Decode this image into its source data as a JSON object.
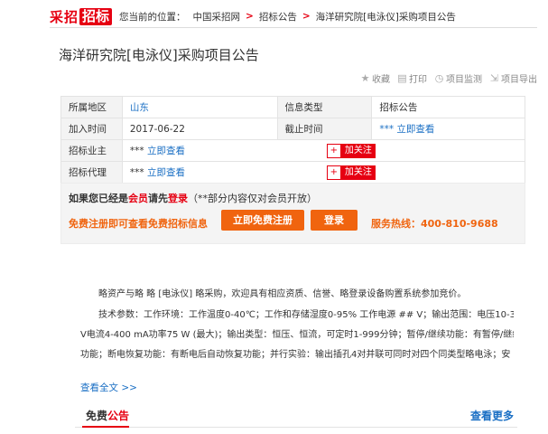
{
  "header": {
    "logo_part1": "采招",
    "logo_part2": "招标",
    "location_label": "您当前的位置：",
    "breadcrumb": [
      "中国采招网",
      "招标公告",
      "海洋研究院[电泳仪]采购项目公告"
    ],
    "separator": ">"
  },
  "title": "海洋研究院[电泳仪]采购项目公告",
  "actions": [
    {
      "icon": "star-icon",
      "glyph": "★",
      "label": "收藏"
    },
    {
      "icon": "print-icon",
      "glyph": "▤",
      "label": "打印"
    },
    {
      "icon": "monitor-icon",
      "glyph": "◷",
      "label": "项目监测"
    },
    {
      "icon": "export-icon",
      "glyph": "⇲",
      "label": "项目导出"
    }
  ],
  "info": {
    "region_label": "所属地区",
    "region_value": "山东",
    "type_label": "信息类型",
    "type_value": "招标公告",
    "join_label": "加入时间",
    "join_value": "2017-06-22",
    "deadline_label": "截止时间",
    "deadline_value": "*** 立即查看",
    "owner_label": "招标业主",
    "owner_stars": "*** ",
    "owner_link": "立即查看",
    "agent_label": "招标代理",
    "agent_stars": "*** ",
    "agent_link": "立即查看",
    "follow_label": "加关注",
    "follow_icon": "+"
  },
  "notice": {
    "line1_pre": "如果您已经是",
    "line1_member": "会员",
    "line1_mid": "请先",
    "line1_login": "登录",
    "line1_note": "（**部分内容仅对会员开放）",
    "promo": "免费注册即可查看免费招标信息",
    "register_button": "立即免费注册",
    "login_button": "登录",
    "hotline": "服务热线：400-810-9688"
  },
  "content": {
    "p1": "略资产与略 略 [电泳仪] 略采购，欢迎具有相应资质、信誉、略登录设备购置系统参加竞价。",
    "p2_l1": "技术参数：工作环境：工作温度0-40℃；工作和存储湿度0-95% 工作电源 ## V；输出范围：电压10-300",
    "p2_l2": "V电流4-400 mA功率75 W (最大)；输出类型：恒压、恒流，可定时1-999分钟；暂停/继续功能：有暂停/继续",
    "p2_l3": "功能；断电恢复功能：有断电后自动恢复功能；并行实验：输出插孔4对并联可同时对四个同类型略电泳；安"
  },
  "view_all": "查看全文 >>",
  "bottom": {
    "tab_pre": "免费",
    "tab_red": "公告",
    "see_more": "查看更多"
  }
}
